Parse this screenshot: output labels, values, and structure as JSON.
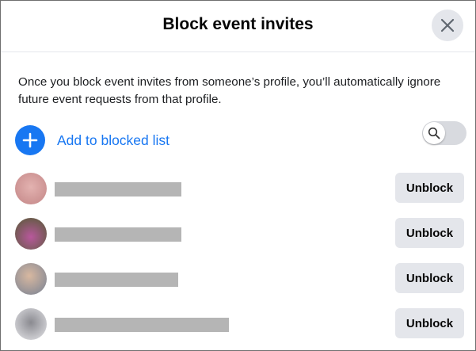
{
  "dialog": {
    "title": "Block event invites",
    "description": "Once you block event invites from someone’s profile, you’ll automatically ignore future event requests from that profile.",
    "add_label": "Add to blocked list",
    "close_icon": "close-icon",
    "add_icon": "plus-icon",
    "search_icon": "search-icon"
  },
  "blocked": {
    "unblock_label": "Unblock",
    "items": [
      {
        "avatar_colors": [
          "#e3b2b0",
          "#c98e8e"
        ]
      },
      {
        "avatar_colors": [
          "#6a5a4a",
          "#b8589c"
        ]
      },
      {
        "avatar_colors": [
          "#d8b8a0",
          "#8a8c96"
        ]
      },
      {
        "avatar_colors": [
          "#d4d4d8",
          "#8a8a90"
        ]
      }
    ]
  },
  "colors": {
    "accent": "#1877f2",
    "button_bg": "#e4e6eb",
    "redaction": "#b5b5b5"
  }
}
